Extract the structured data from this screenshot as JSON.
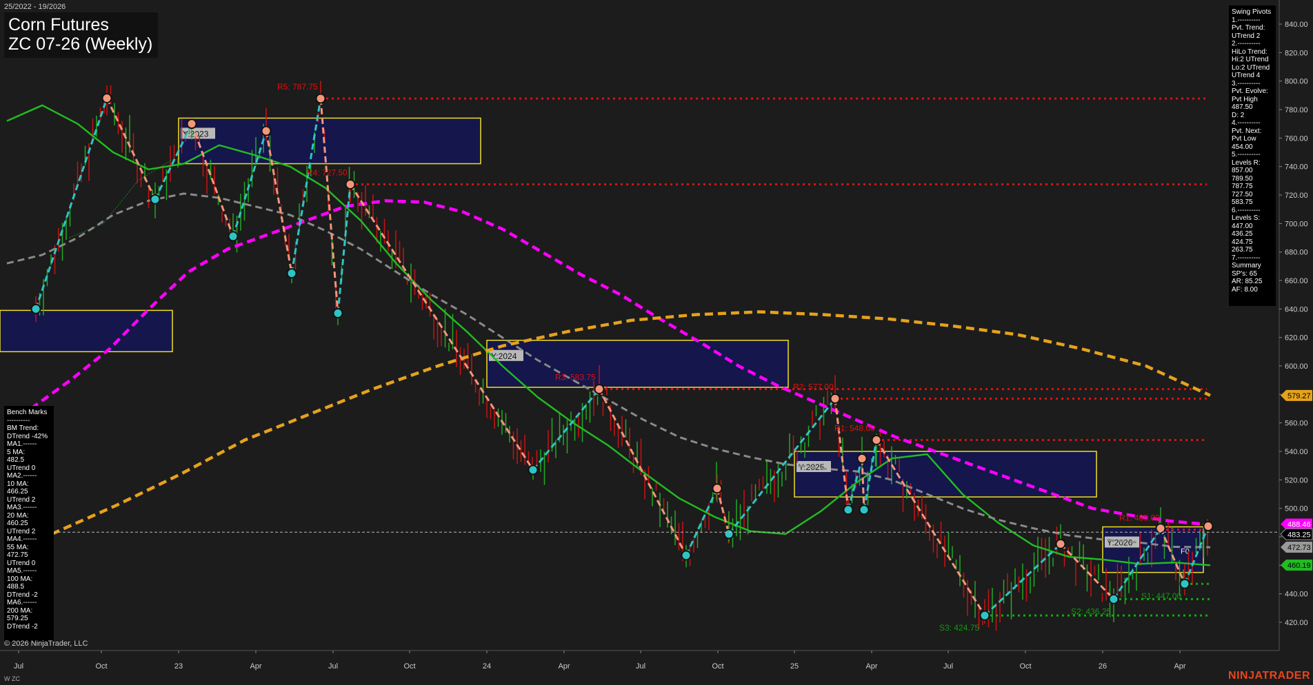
{
  "header": {
    "date_range": "25/2022 - 19/2026",
    "title_line1": "Corn Futures",
    "title_line2": "ZC 07-26 (Weekly)"
  },
  "footer": {
    "copyright": "© 2026 NinjaTrader, LLC",
    "instrument": "W ZC",
    "brand": "NINJATRADER"
  },
  "bench_marks": {
    "lines": [
      "Bench Marks",
      "----------",
      "BM Trend:",
      "DTrend -42%",
      "MA1.------",
      "5 MA:",
      "482.5",
      "UTrend 0",
      "MA2.------",
      "10 MA:",
      "466.25",
      "UTrend 2",
      "MA3.------",
      "20 MA:",
      "460.25",
      "UTrend 2",
      "MA4.------",
      "55 MA:",
      "472.75",
      "UTrend 0",
      "MA5.------",
      "100 MA:",
      "488.5",
      "DTrend -2",
      "MA6.------",
      "200 MA:",
      "579.25",
      "DTrend -2"
    ]
  },
  "swing_pivots": {
    "lines": [
      "Swing Pivots",
      "1.----------",
      "Pvt. Trend:",
      "UTrend 2",
      "2.----------",
      "HiLo Trend:",
      "Hi:2 UTrend",
      "Lo:2 UTrend",
      "UTrend 4",
      "3.----------",
      "Pvt. Evolve:",
      "Pvt High",
      "487.50",
      "D: 2",
      "4.----------",
      "Pvt. Next:",
      "Pvt Low",
      "454.00",
      "5.----------",
      "Levels R:",
      "857.00",
      "789.50",
      "787.75",
      "727.50",
      "583.75",
      "6.----------",
      "Levels S:",
      "447.00",
      "436.25",
      "424.75",
      "263.75",
      "7.----------",
      "Summary",
      "SP's: 65",
      "AR: 85.25",
      "AF: 8.00"
    ]
  },
  "chart_data": {
    "type": "line",
    "title": "ZC 07-26 (Weekly)",
    "y_axis": {
      "ticks": [
        840,
        820,
        800,
        780,
        760,
        740,
        720,
        700,
        680,
        660,
        640,
        620,
        600,
        580,
        560,
        540,
        520,
        500,
        480,
        460,
        440,
        420
      ],
      "tick_labels": [
        "840.00",
        "820.00",
        "800.00",
        "780.00",
        "760.00",
        "740.00",
        "720.00",
        "700.00",
        "680.00",
        "660.00",
        "640.00",
        "620.00",
        "600.00",
        "580.00",
        "560.00",
        "540.00",
        "520.00",
        "500.00",
        "480.00",
        "460.00",
        "440.00",
        "420.00"
      ],
      "range": [
        406,
        848
      ]
    },
    "x_axis": {
      "tick_labels": [
        "Jul",
        "Oct",
        "23",
        "Apr",
        "Jul",
        "Oct",
        "24",
        "Apr",
        "Jul",
        "Oct",
        "25",
        "Apr",
        "Jul",
        "Oct",
        "26",
        "Apr"
      ]
    },
    "price_badges": [
      {
        "text": "579.27",
        "value": 579.27,
        "color": "#e6a21c",
        "text_color": "#000000"
      },
      {
        "text": "488.46",
        "value": 488.46,
        "color": "#ff00ff",
        "text_color": "#ffffff"
      },
      {
        "text": "483.25",
        "value": 483.25,
        "color": "#000000",
        "text_color": "#ffffff"
      },
      {
        "text": "472.73",
        "value": 472.73,
        "color": "#9a9a9a",
        "text_color": "#000000"
      },
      {
        "text": "460.19",
        "value": 460.19,
        "color": "#22bb22",
        "text_color": "#000000"
      }
    ],
    "resistance_levels": [
      {
        "label": "R5: 787.75",
        "value": 787.75
      },
      {
        "label": "R4: 727.50",
        "value": 727.5
      },
      {
        "label": "R3: 583.75",
        "value": 583.75
      },
      {
        "label": "R2: 577.00",
        "value": 577.0
      },
      {
        "label": "R1: 548.00",
        "value": 548.0
      },
      {
        "label": "R1: 485.00",
        "value": 485.0
      }
    ],
    "support_levels": [
      {
        "label": "S1: 447.00",
        "value": 447.0
      },
      {
        "label": "S2: 436.25",
        "value": 436.25
      },
      {
        "label": "S3: 424.75",
        "value": 424.75
      }
    ],
    "yearly_boxes": [
      {
        "label": "Y:2023",
        "high": 774,
        "low": 742
      },
      {
        "label": "",
        "high": 639,
        "low": 610
      },
      {
        "label": "Y:2024",
        "high": 618,
        "low": 585
      },
      {
        "label": "Y:2025",
        "high": 540,
        "low": 508
      },
      {
        "label": "Y:2026",
        "high": 487,
        "low": 455
      }
    ],
    "box_label_f": "F0",
    "moving_averages": [
      {
        "name": "20 MA",
        "color": "#22bb22",
        "values": [
          772,
          783,
          770,
          750,
          738,
          742,
          755,
          748,
          740,
          725,
          702,
          672,
          646,
          624,
          600,
          578,
          560,
          544,
          525,
          507,
          494,
          484,
          482,
          498,
          518,
          535,
          538,
          510,
          490,
          474,
          466,
          464,
          461,
          462,
          460
        ]
      },
      {
        "name": "55 MA",
        "color": "#8a8a8a",
        "values": [
          672,
          678,
          690,
          706,
          716,
          721,
          718,
          712,
          706,
          695,
          682,
          666,
          650,
          636,
          620,
          604,
          590,
          576,
          562,
          550,
          542,
          536,
          531,
          528,
          526,
          520,
          510,
          500,
          492,
          486,
          481,
          478,
          476,
          473,
          472.7
        ]
      },
      {
        "name": "100 MA",
        "color": "#ff00ff",
        "values": [
          570,
          590,
          612,
          640,
          666,
          682,
          692,
          702,
          712,
          716,
          715,
          708,
          696,
          680,
          664,
          650,
          633,
          617,
          600,
          586,
          574,
          562,
          550,
          540,
          530,
          520,
          510,
          500,
          495,
          491,
          488.5
        ]
      },
      {
        "name": "200 MA",
        "color": "#e6a21c",
        "values": [
          482,
          502,
          524,
          548,
          566,
          584,
          600,
          614,
          624,
          632,
          636,
          638,
          636,
          633,
          628,
          622,
          612,
          600,
          579.3
        ]
      }
    ],
    "swing_points": [
      {
        "type": "low",
        "value": 640
      },
      {
        "type": "high",
        "value": 788
      },
      {
        "type": "low",
        "value": 717
      },
      {
        "type": "high",
        "value": 770
      },
      {
        "type": "low",
        "value": 691
      },
      {
        "type": "high",
        "value": 765
      },
      {
        "type": "low",
        "value": 665
      },
      {
        "type": "high",
        "value": 787.75
      },
      {
        "type": "low",
        "value": 637
      },
      {
        "type": "high",
        "value": 727.5
      },
      {
        "type": "low",
        "value": 527
      },
      {
        "type": "high",
        "value": 583.75
      },
      {
        "type": "low",
        "value": 467
      },
      {
        "type": "high",
        "value": 514
      },
      {
        "type": "low",
        "value": 482
      },
      {
        "type": "high",
        "value": 577
      },
      {
        "type": "low",
        "value": 499
      },
      {
        "type": "high",
        "value": 535
      },
      {
        "type": "low",
        "value": 499
      },
      {
        "type": "high",
        "value": 548
      },
      {
        "type": "low",
        "value": 424.75
      },
      {
        "type": "high",
        "value": 475
      },
      {
        "type": "low",
        "value": 436.25
      },
      {
        "type": "high",
        "value": 486
      },
      {
        "type": "low",
        "value": 447
      },
      {
        "type": "high",
        "value": 487.5
      }
    ]
  }
}
